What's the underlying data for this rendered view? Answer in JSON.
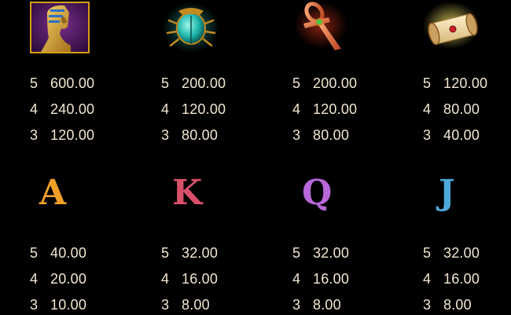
{
  "paytable": {
    "rows": [
      {
        "symbols": [
          {
            "name": "nefertiti",
            "icon": "nefertiti-bust-icon",
            "payouts": [
              {
                "count": "5",
                "value": "600.00"
              },
              {
                "count": "4",
                "value": "240.00"
              },
              {
                "count": "3",
                "value": "120.00"
              }
            ]
          },
          {
            "name": "scarab",
            "icon": "scarab-beetle-icon",
            "payouts": [
              {
                "count": "5",
                "value": "200.00"
              },
              {
                "count": "4",
                "value": "120.00"
              },
              {
                "count": "3",
                "value": "80.00"
              }
            ]
          },
          {
            "name": "ankh",
            "icon": "ankh-icon",
            "payouts": [
              {
                "count": "5",
                "value": "200.00"
              },
              {
                "count": "4",
                "value": "120.00"
              },
              {
                "count": "3",
                "value": "80.00"
              }
            ]
          },
          {
            "name": "scroll",
            "icon": "papyrus-scroll-icon",
            "payouts": [
              {
                "count": "5",
                "value": "120.00"
              },
              {
                "count": "4",
                "value": "80.00"
              },
              {
                "count": "3",
                "value": "40.00"
              }
            ]
          }
        ]
      },
      {
        "symbols": [
          {
            "name": "A",
            "icon": "letter-a-icon",
            "letter": "A",
            "color": "#f0a02a",
            "payouts": [
              {
                "count": "5",
                "value": "40.00"
              },
              {
                "count": "4",
                "value": "20.00"
              },
              {
                "count": "3",
                "value": "10.00"
              }
            ]
          },
          {
            "name": "K",
            "icon": "letter-k-icon",
            "letter": "K",
            "color": "#d9506a",
            "payouts": [
              {
                "count": "5",
                "value": "32.00"
              },
              {
                "count": "4",
                "value": "16.00"
              },
              {
                "count": "3",
                "value": "8.00"
              }
            ]
          },
          {
            "name": "Q",
            "icon": "letter-q-icon",
            "letter": "Q",
            "color": "#b868d8",
            "payouts": [
              {
                "count": "5",
                "value": "32.00"
              },
              {
                "count": "4",
                "value": "16.00"
              },
              {
                "count": "3",
                "value": "8.00"
              }
            ]
          },
          {
            "name": "J",
            "icon": "letter-j-icon",
            "letter": "J",
            "color": "#4ea8d8",
            "payouts": [
              {
                "count": "5",
                "value": "32.00"
              },
              {
                "count": "4",
                "value": "16.00"
              },
              {
                "count": "3",
                "value": "8.00"
              }
            ]
          }
        ]
      }
    ]
  },
  "colors": {
    "background": "#000000",
    "payout_text": "#f2e6cf",
    "nefertiti_frame": "#d4a017",
    "scarab": "#2fd3c6",
    "ankh": "#e0703a",
    "scroll": "#f4e3a4"
  }
}
